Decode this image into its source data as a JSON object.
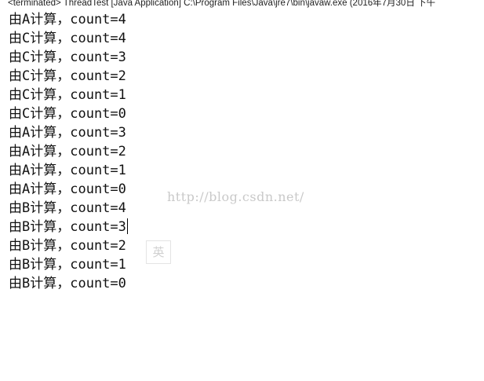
{
  "console": {
    "header": "<terminated> ThreadTest [Java Application] C:\\Program Files\\Java\\jre7\\bin\\javaw.exe (2016年7月30日 下午",
    "lines": [
      "由A计算，count=4",
      "由C计算，count=4",
      "由C计算，count=3",
      "由C计算，count=2",
      "由C计算，count=1",
      "由C计算，count=0",
      "由A计算，count=3",
      "由A计算，count=2",
      "由A计算，count=1",
      "由A计算，count=0",
      "由B计算，count=4",
      "由B计算，count=3",
      "由B计算，count=2",
      "由B计算，count=1",
      "由B计算，count=0"
    ]
  },
  "watermark": "http://blog.csdn.net/",
  "ime": {
    "label": "英"
  }
}
